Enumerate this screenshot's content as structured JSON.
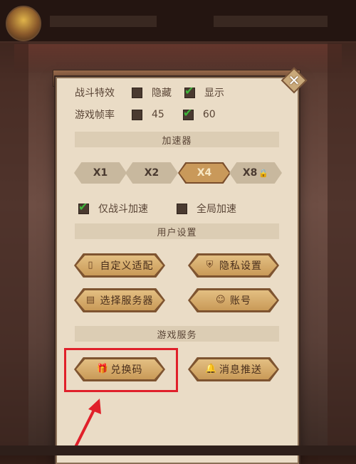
{
  "settings": {
    "battle_effects": {
      "label": "战斗特效",
      "options": [
        {
          "label": "隐藏",
          "checked": false
        },
        {
          "label": "显示",
          "checked": true
        }
      ]
    },
    "frame_rate": {
      "label": "游戏帧率",
      "options": [
        {
          "label": "45",
          "checked": false
        },
        {
          "label": "60",
          "checked": true
        }
      ]
    }
  },
  "sections": {
    "accelerator": "加速器",
    "user_settings": "用户设置",
    "game_services": "游戏服务"
  },
  "speed_options": [
    {
      "label": "X1",
      "active": false
    },
    {
      "label": "X2",
      "active": false
    },
    {
      "label": "X4",
      "active": true
    },
    {
      "label": "X8",
      "active": false,
      "locked": true
    }
  ],
  "accel_scope": [
    {
      "label": "仅战斗加速",
      "checked": true
    },
    {
      "label": "全局加速",
      "checked": false
    }
  ],
  "buttons": {
    "custom_adapt": "自定义适配",
    "privacy": "隐私设置",
    "select_server": "选择服务器",
    "account": "账号",
    "redeem_code": "兑换码",
    "notifications": "消息推送"
  },
  "colors": {
    "highlight_box": "#e0202a",
    "check_green": "#3fb63a",
    "panel_bg": "#eadcc6"
  }
}
